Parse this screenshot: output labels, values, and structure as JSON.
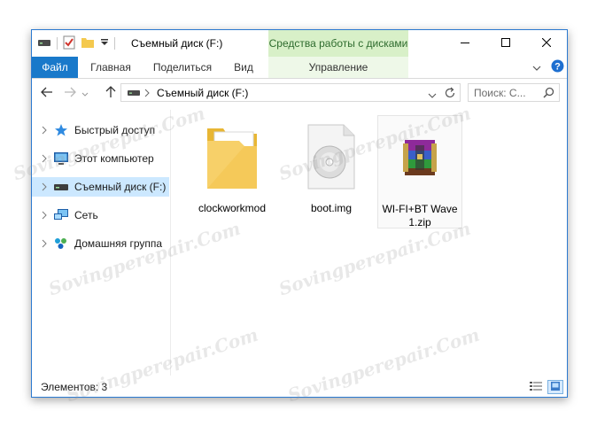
{
  "window": {
    "title": "Съемный диск (F:)",
    "context_group": "Средства работы с дисками"
  },
  "ribbon": {
    "tabs": [
      {
        "label": "Файл"
      },
      {
        "label": "Главная"
      },
      {
        "label": "Поделиться"
      },
      {
        "label": "Вид"
      },
      {
        "label": "Управление"
      }
    ]
  },
  "address": {
    "path": "Съемный диск (F:)"
  },
  "search": {
    "placeholder": "Поиск: С..."
  },
  "navpane": {
    "items": [
      {
        "label": "Быстрый доступ",
        "icon": "star-icon"
      },
      {
        "label": "Этот компьютер",
        "icon": "computer-icon"
      },
      {
        "label": "Съемный диск (F:)",
        "icon": "drive-icon",
        "selected": true
      },
      {
        "label": "Сеть",
        "icon": "network-icon"
      },
      {
        "label": "Домашняя группа",
        "icon": "homegroup-icon"
      }
    ]
  },
  "files": [
    {
      "name": "clockworkmod",
      "type": "folder"
    },
    {
      "name": "boot.img",
      "type": "disc-image"
    },
    {
      "name": "WI-FI+BT Wave 1.zip",
      "type": "winrar-archive"
    }
  ],
  "status": {
    "count": "Элементов: 3"
  },
  "watermark": {
    "text": "Sovingperepair.Com"
  },
  "colors": {
    "accent": "#1979ca",
    "context_tab": "#d8f0c8",
    "selection": "#cce8ff"
  }
}
